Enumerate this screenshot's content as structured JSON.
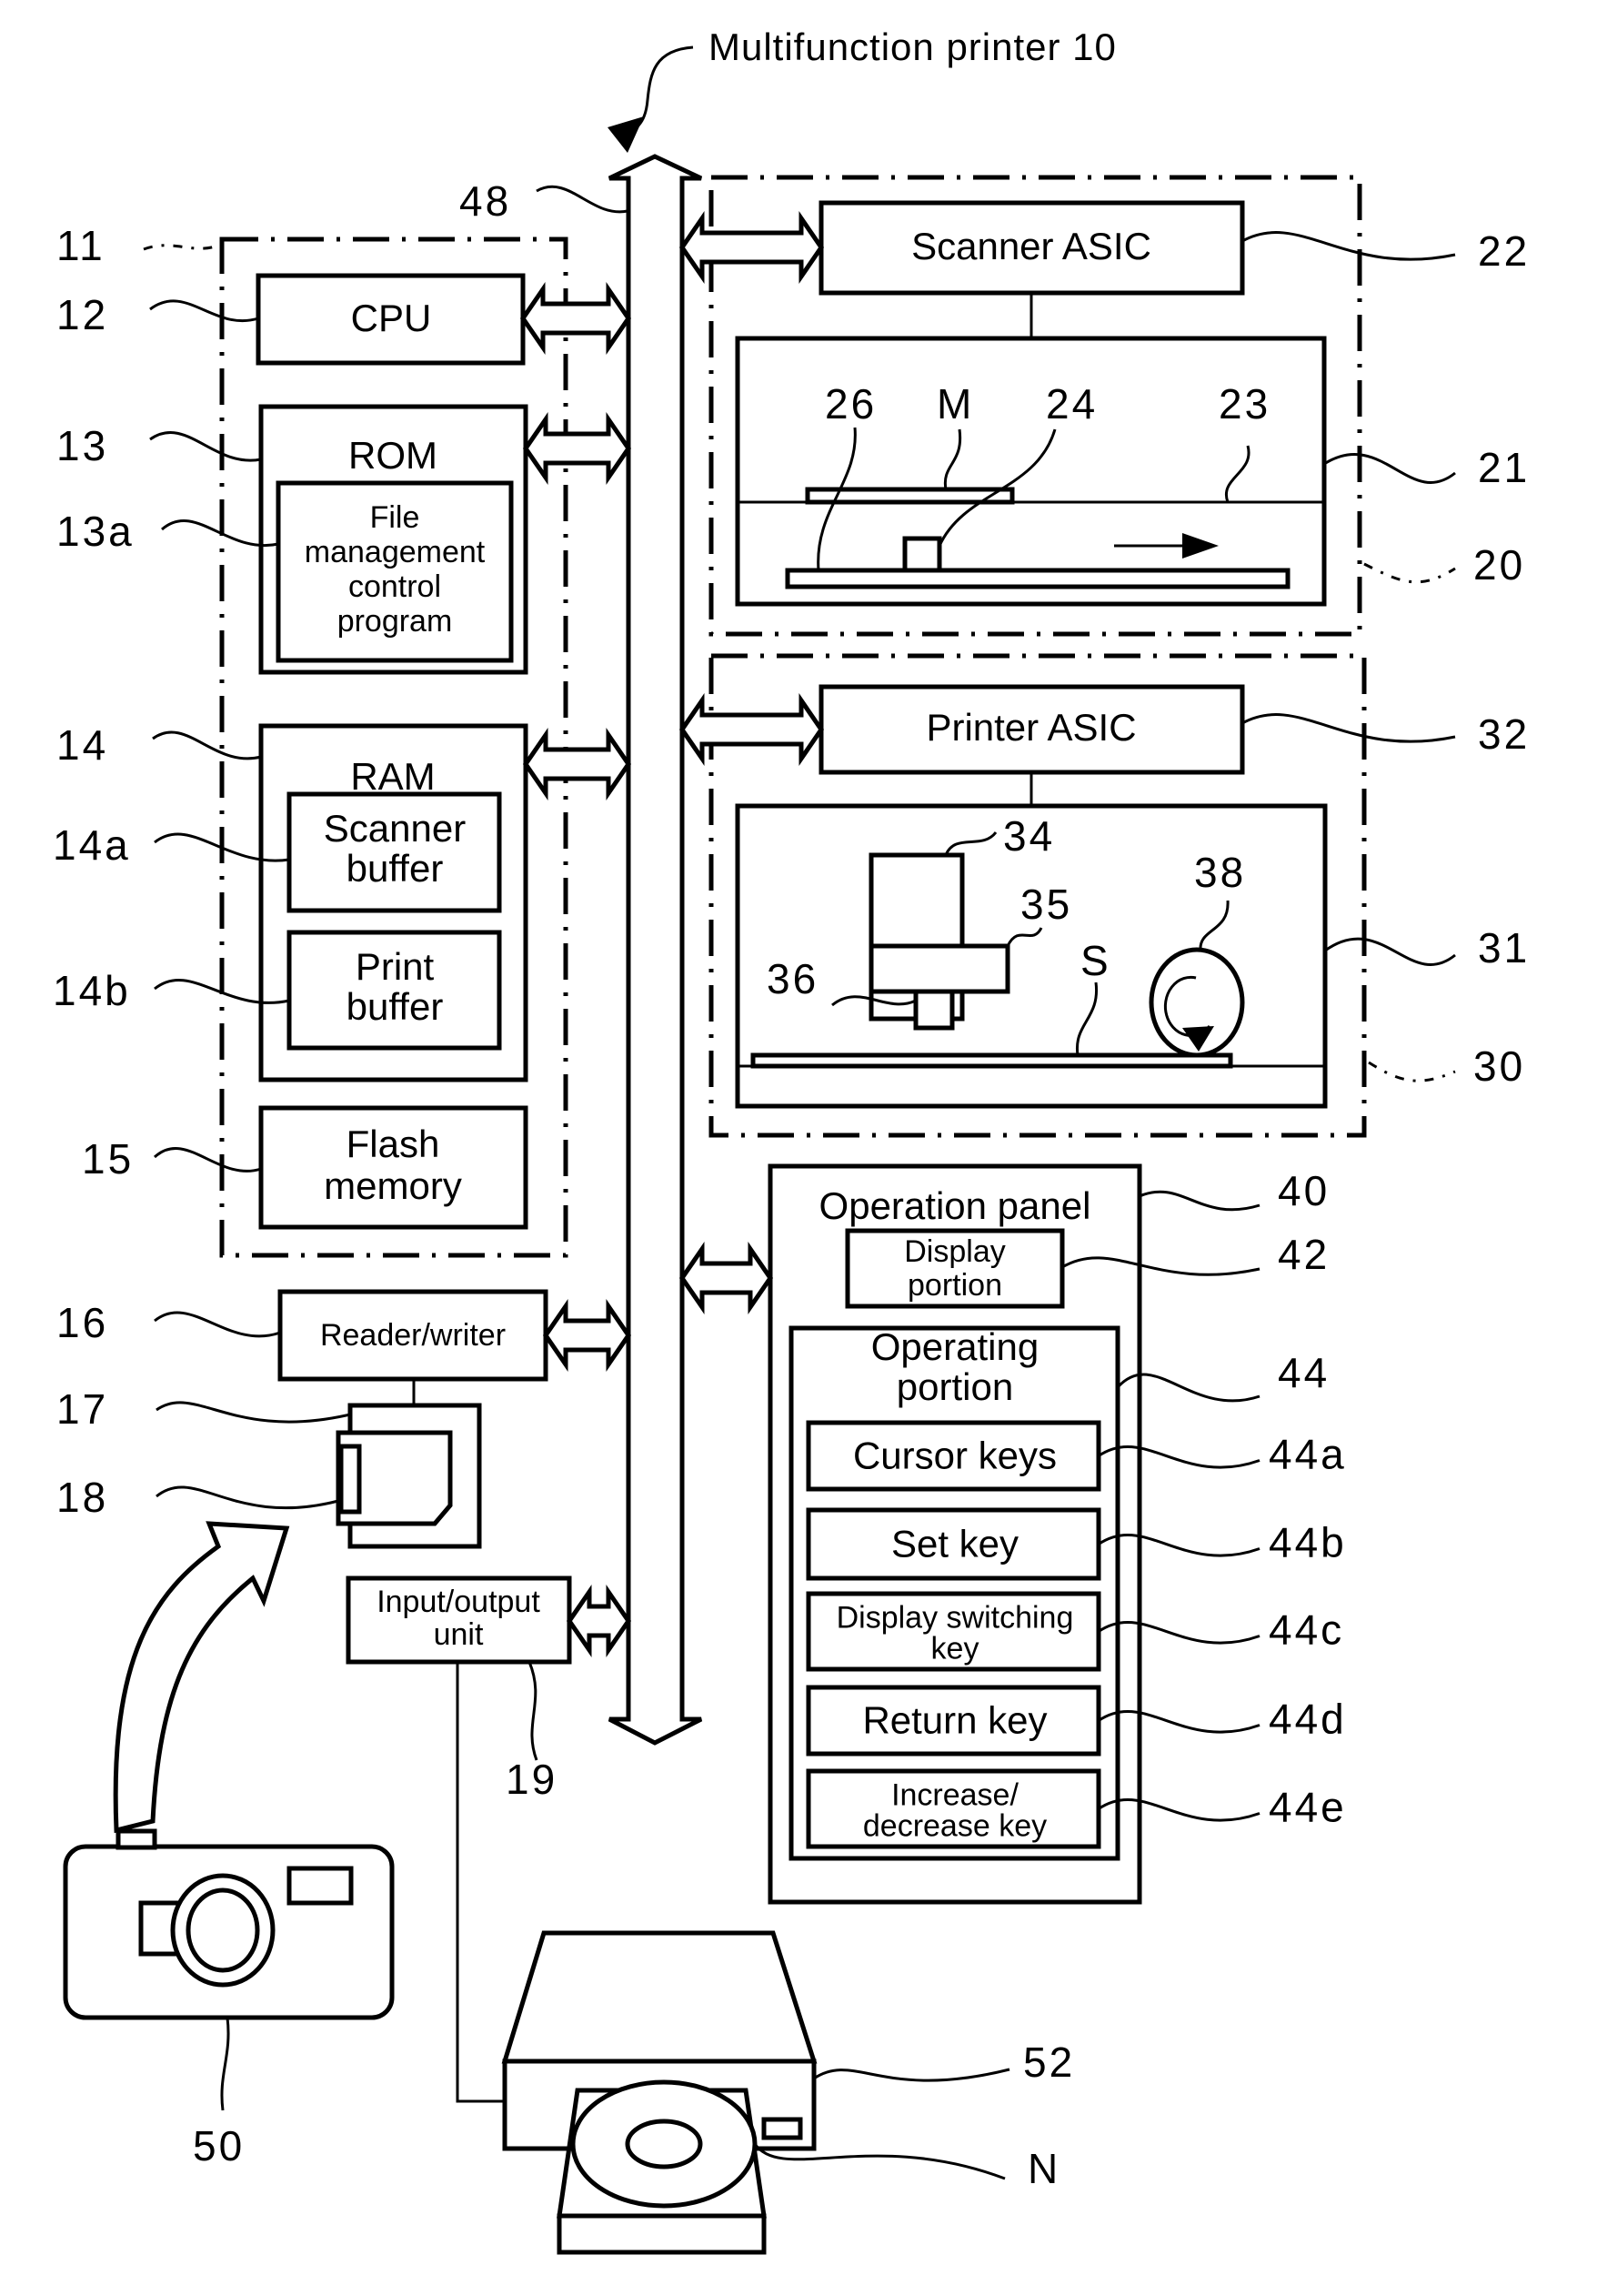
{
  "figure": {
    "title": "Multifunction printer 10",
    "bus_ref": "48"
  },
  "control_unit": {
    "ref": "11",
    "cpu": {
      "ref": "12",
      "label": "CPU"
    },
    "rom": {
      "ref": "13",
      "label": "ROM",
      "program": {
        "ref": "13a",
        "lines": [
          "File",
          "management",
          "control",
          "program"
        ]
      }
    },
    "ram": {
      "ref": "14",
      "label": "RAM",
      "scanner_buffer": {
        "ref": "14a",
        "lines": [
          "Scanner",
          "buffer"
        ]
      },
      "print_buffer": {
        "ref": "14b",
        "lines": [
          "Print",
          "buffer"
        ]
      }
    },
    "flash": {
      "ref": "15",
      "lines": [
        "Flash",
        "memory"
      ]
    }
  },
  "reader_writer": {
    "ref": "16",
    "label": "Reader/writer"
  },
  "card_slot": {
    "ref": "17"
  },
  "memory_card": {
    "ref": "18"
  },
  "io_unit": {
    "ref": "19",
    "lines": [
      "Input/output",
      "unit"
    ]
  },
  "scanner": {
    "ref": "20",
    "asic": {
      "ref": "22",
      "label": "Scanner ASIC"
    },
    "mechanism": {
      "ref": "21"
    },
    "glass": {
      "ref": "23"
    },
    "sensor": {
      "ref": "24"
    },
    "rail": {
      "ref": "26"
    },
    "document": {
      "ref": "M"
    }
  },
  "printer": {
    "ref": "30",
    "asic": {
      "ref": "32",
      "label": "Printer ASIC"
    },
    "mechanism": {
      "ref": "31"
    },
    "carriage": {
      "ref": "34"
    },
    "head": {
      "ref": "35"
    },
    "nozzle": {
      "ref": "36"
    },
    "roller": {
      "ref": "38"
    },
    "sheet": {
      "ref": "S"
    }
  },
  "operation_panel": {
    "ref": "40",
    "label": "Operation panel",
    "display": {
      "ref": "42",
      "lines": [
        "Display",
        "portion"
      ]
    },
    "operating": {
      "ref": "44",
      "lines": [
        "Operating",
        "portion"
      ],
      "keys": [
        {
          "ref": "44a",
          "lines": [
            "Cursor keys"
          ]
        },
        {
          "ref": "44b",
          "lines": [
            "Set key"
          ]
        },
        {
          "ref": "44c",
          "lines": [
            "Display switching",
            "key"
          ]
        },
        {
          "ref": "44d",
          "lines": [
            "Return key"
          ]
        },
        {
          "ref": "44e",
          "lines": [
            "Increase/",
            "decrease key"
          ]
        }
      ]
    }
  },
  "camera": {
    "ref": "50"
  },
  "drive": {
    "ref": "52"
  },
  "disc": {
    "ref": "N"
  }
}
